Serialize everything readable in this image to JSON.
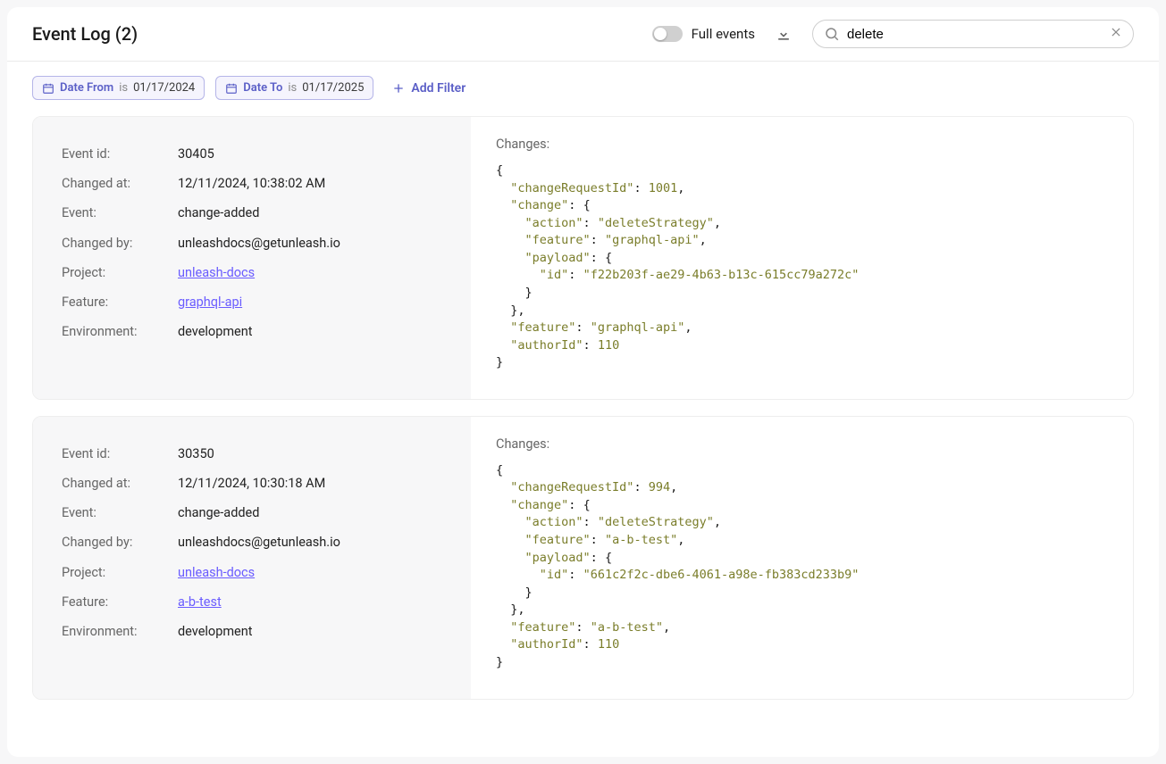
{
  "header": {
    "title": "Event Log (2)",
    "toggle_label": "Full events",
    "search_value": "delete",
    "search_placeholder": "Search"
  },
  "filters": {
    "date_from": {
      "label": "Date From",
      "op": "is",
      "value": "01/17/2024"
    },
    "date_to": {
      "label": "Date To",
      "op": "is",
      "value": "01/17/2025"
    },
    "add_label": "Add Filter"
  },
  "labels": {
    "event_id": "Event id:",
    "changed_at": "Changed at:",
    "event": "Event:",
    "changed_by": "Changed by:",
    "project": "Project:",
    "feature": "Feature:",
    "environment": "Environment:",
    "changes": "Changes:"
  },
  "events": [
    {
      "id": "30405",
      "changed_at": "12/11/2024, 10:38:02 AM",
      "event": "change-added",
      "changed_by": "unleashdocs@getunleash.io",
      "project": "unleash-docs",
      "feature": "graphql-api",
      "environment": "development",
      "changes": {
        "changeRequestId": 1001,
        "change": {
          "action": "deleteStrategy",
          "feature": "graphql-api",
          "payload": {
            "id": "f22b203f-ae29-4b63-b13c-615cc79a272c"
          }
        },
        "feature": "graphql-api",
        "authorId": 110
      }
    },
    {
      "id": "30350",
      "changed_at": "12/11/2024, 10:30:18 AM",
      "event": "change-added",
      "changed_by": "unleashdocs@getunleash.io",
      "project": "unleash-docs",
      "feature": "a-b-test",
      "environment": "development",
      "changes": {
        "changeRequestId": 994,
        "change": {
          "action": "deleteStrategy",
          "feature": "a-b-test",
          "payload": {
            "id": "661c2f2c-dbe6-4061-a98e-fb383cd233b9"
          }
        },
        "feature": "a-b-test",
        "authorId": 110
      }
    }
  ]
}
